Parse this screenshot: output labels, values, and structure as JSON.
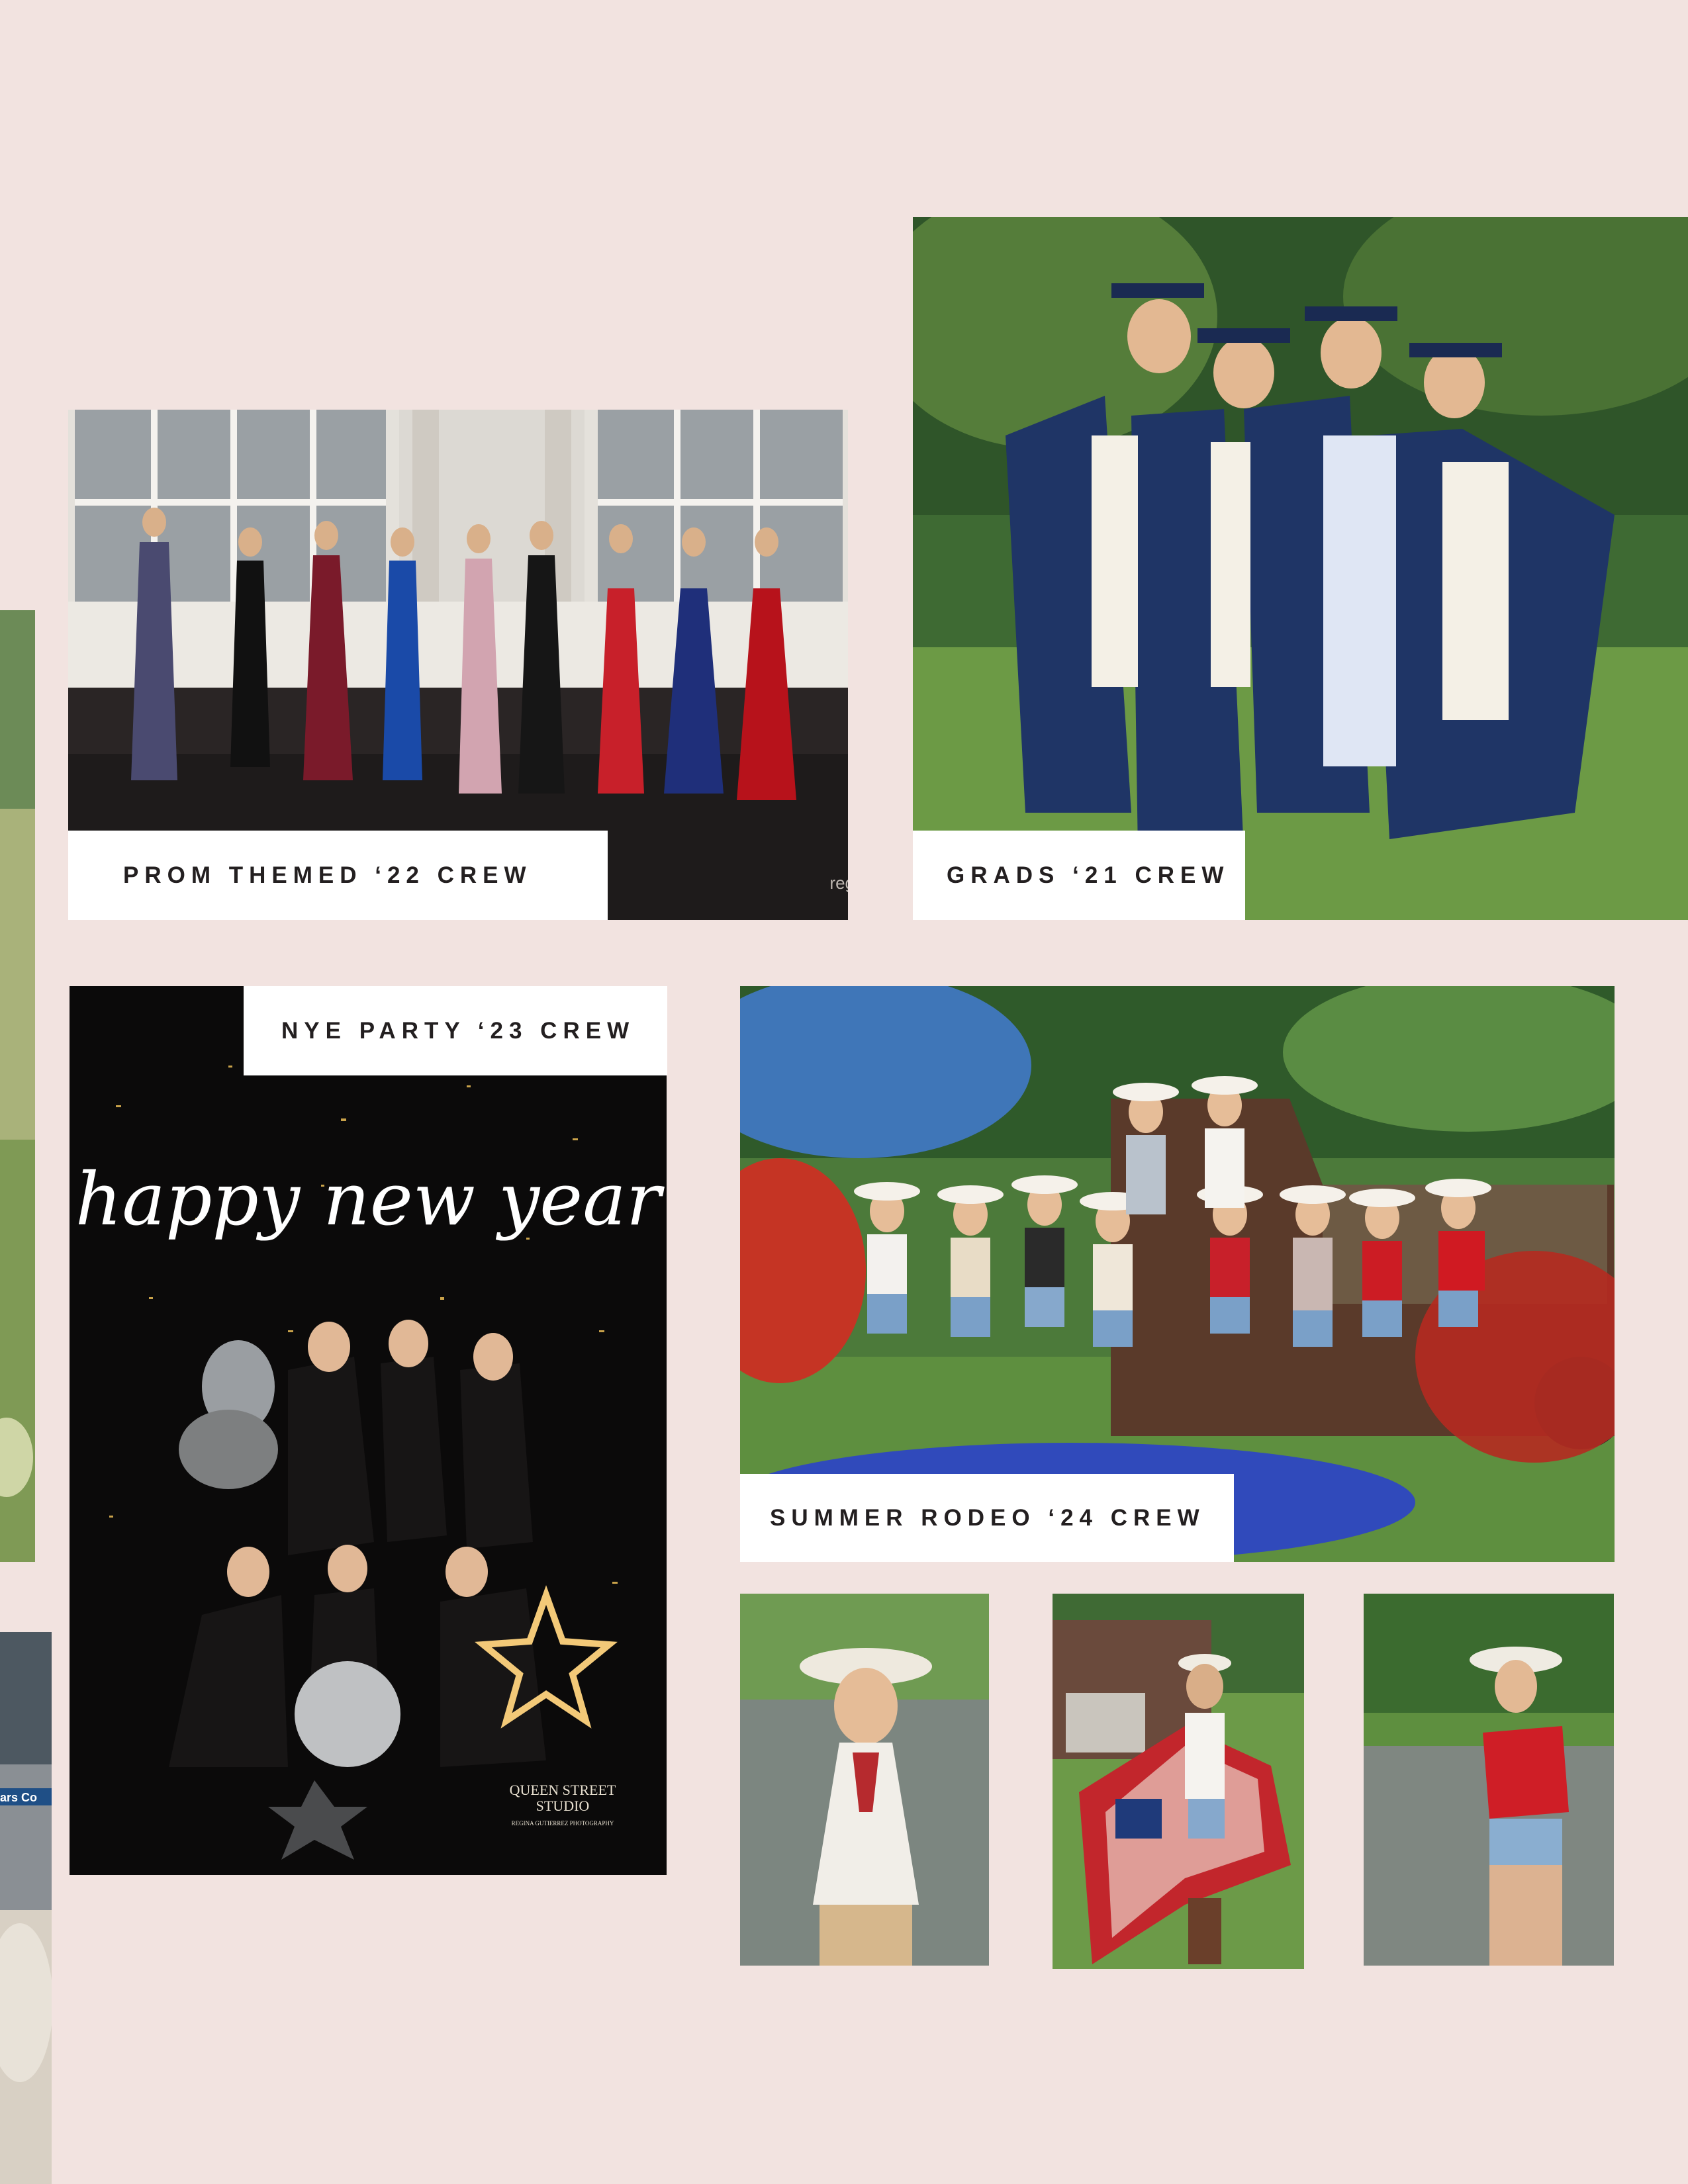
{
  "page": {
    "background": "#f2e3e0"
  },
  "galleries": {
    "prom": {
      "label": "PROM THEMED ‘22 CREW",
      "watermark": "reg"
    },
    "grads": {
      "label": "GRADS ‘21 CREW"
    },
    "nye": {
      "label": "NYE PARTY ‘23 CREW",
      "script_text": "happy new year",
      "studio_name_line1": "QUEEN STREET",
      "studio_name_line2": "STUDIO",
      "studio_credit": "REGINA GUTIERREZ PHOTOGRAPHY"
    },
    "rodeo": {
      "label": "SUMMER RODEO ‘24 CREW"
    },
    "left_edge_sign": "ars Co"
  },
  "colors": {
    "label_bg": "#ffffff",
    "label_text": "#231f20",
    "grad_gown": "#1f3566",
    "nye_bg": "#0b0a0a",
    "gold": "#c9a24a"
  }
}
